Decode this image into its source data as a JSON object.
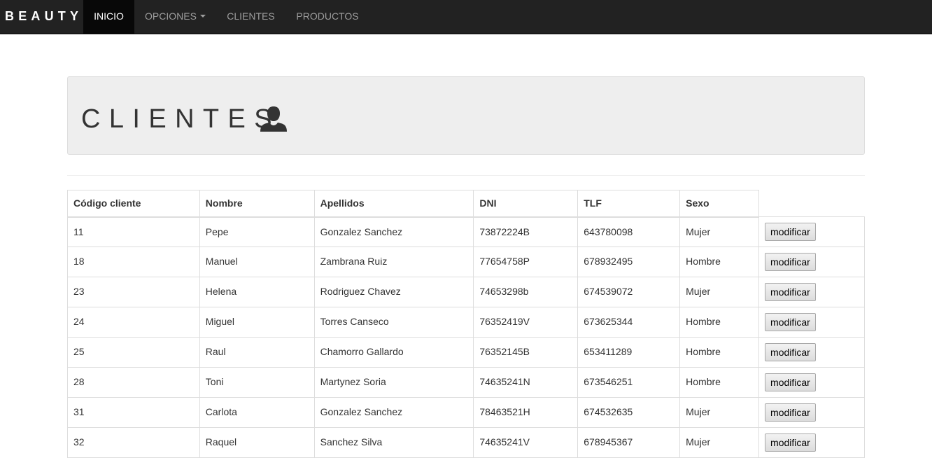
{
  "navbar": {
    "brand": "BEAUTY",
    "items": [
      {
        "label": "INICIO"
      },
      {
        "label": "OPCIONES"
      },
      {
        "label": "CLIENTES"
      },
      {
        "label": "PRODUCTOS"
      }
    ]
  },
  "header": {
    "title": "CLIENTES"
  },
  "table": {
    "headers": [
      "Código cliente",
      "Nombre",
      "Apellidos",
      "DNI",
      "TLF",
      "Sexo"
    ],
    "action_label": "modificar",
    "rows": [
      [
        "11",
        "Pepe",
        "Gonzalez Sanchez",
        "73872224B",
        "643780098",
        "Mujer"
      ],
      [
        "18",
        "Manuel",
        "Zambrana Ruiz",
        "77654758P",
        "678932495",
        "Hombre"
      ],
      [
        "23",
        "Helena",
        "Rodriguez Chavez",
        "74653298b",
        "674539072",
        "Mujer"
      ],
      [
        "24",
        "Miguel",
        "Torres Canseco",
        "76352419V",
        "673625344",
        "Hombre"
      ],
      [
        "25",
        "Raul",
        "Chamorro Gallardo",
        "76352145B",
        "653411289",
        "Hombre"
      ],
      [
        "28",
        "Toni",
        "Martynez Soria",
        "74635241N",
        "673546251",
        "Hombre"
      ],
      [
        "31",
        "Carlota",
        "Gonzalez Sanchez",
        "78463521H",
        "674532635",
        "Mujer"
      ],
      [
        "32",
        "Raquel",
        "Sanchez Silva",
        "74635241V",
        "678945367",
        "Mujer"
      ]
    ]
  },
  "colors": {
    "navbar_bg": "#222222",
    "active_bg": "#080808",
    "jumbotron_bg": "#eeeeee"
  },
  "icons": {
    "header_icon": "user-icon",
    "dropdown_icon": "caret-down-icon"
  }
}
